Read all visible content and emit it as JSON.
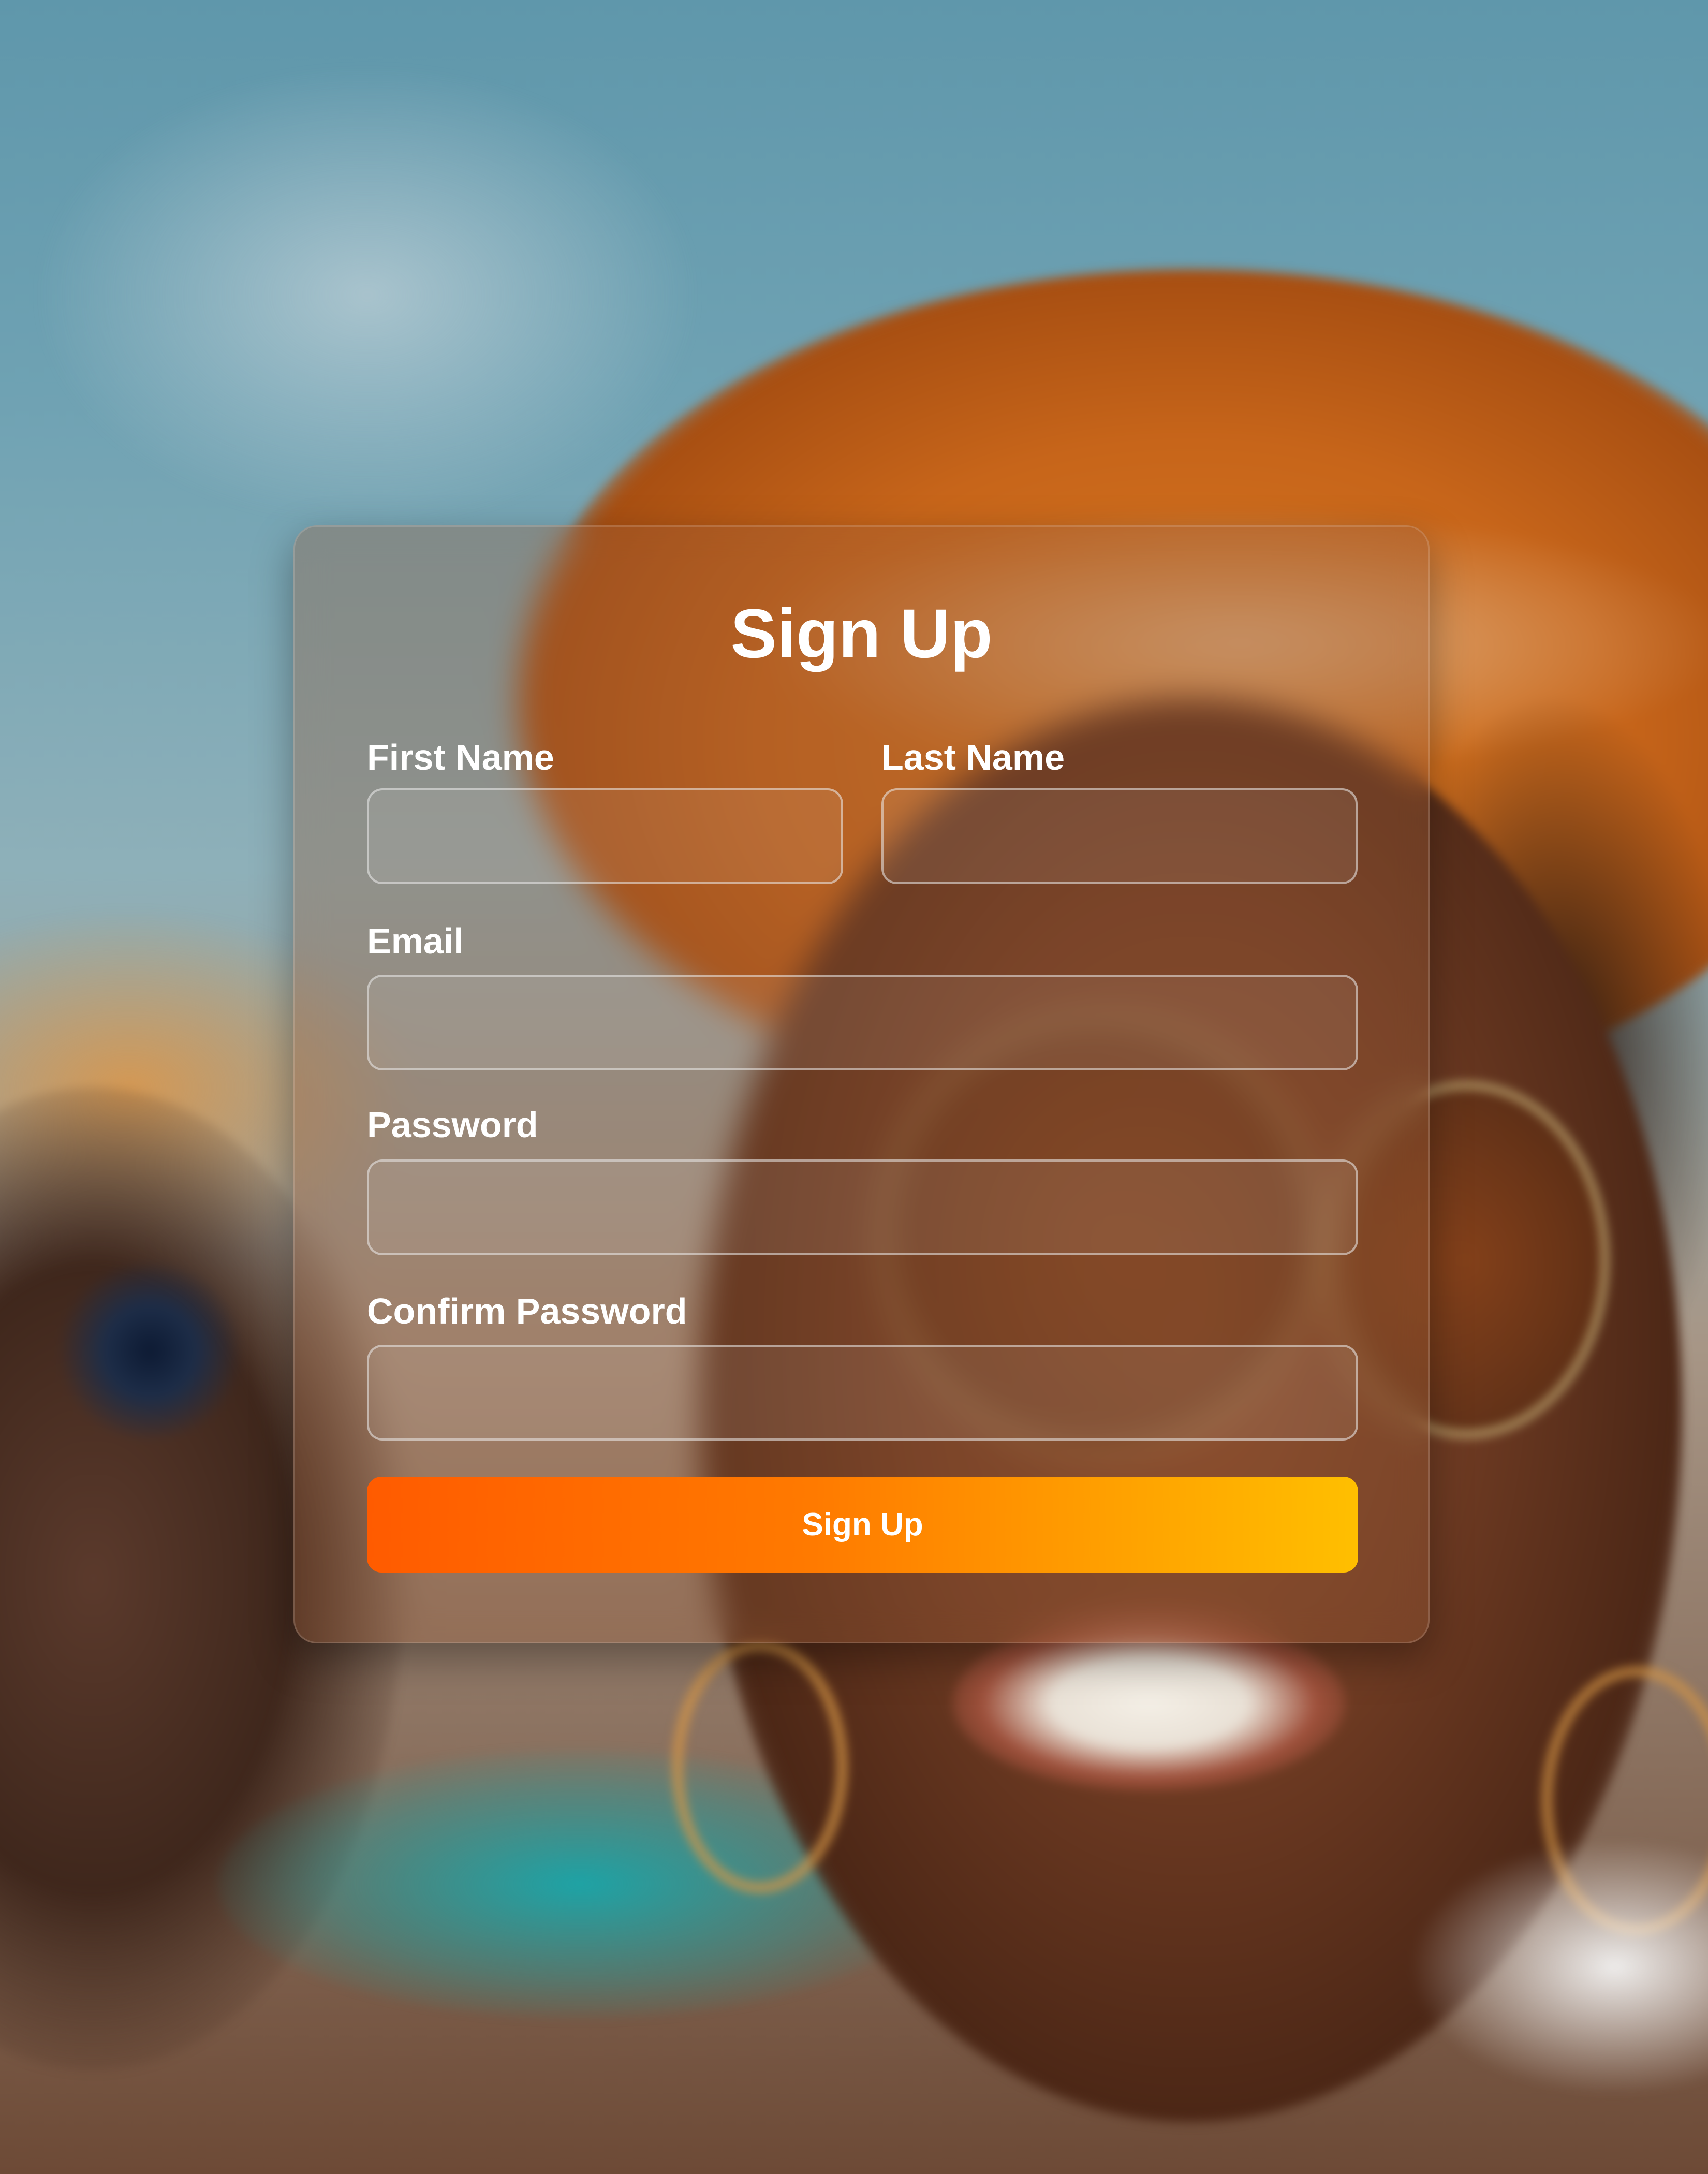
{
  "form": {
    "title": "Sign Up",
    "fields": {
      "first_name": {
        "label": "First Name",
        "value": "",
        "placeholder": ""
      },
      "last_name": {
        "label": "Last Name",
        "value": "",
        "placeholder": ""
      },
      "email": {
        "label": "Email",
        "value": "",
        "placeholder": ""
      },
      "password": {
        "label": "Password",
        "value": "",
        "placeholder": ""
      },
      "confirm_password": {
        "label": "Confirm Password",
        "value": "",
        "placeholder": ""
      }
    },
    "submit_label": "Sign Up"
  },
  "colors": {
    "button_gradient_start": "#ff5b00",
    "button_gradient_end": "#ffbf00",
    "text": "#ffffff"
  }
}
